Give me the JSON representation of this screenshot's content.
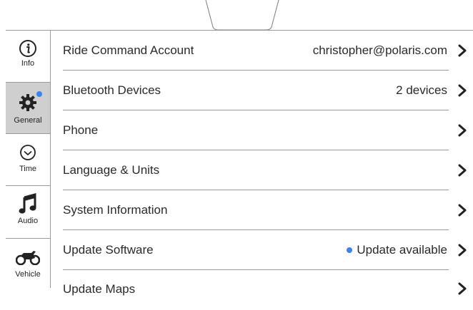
{
  "sidebar": {
    "items": [
      {
        "label": "Info",
        "icon": "info-icon"
      },
      {
        "label": "General",
        "icon": "gear-icon",
        "active": true,
        "badge": true
      },
      {
        "label": "Time",
        "icon": "clock-icon"
      },
      {
        "label": "Audio",
        "icon": "music-note-icon"
      },
      {
        "label": "Vehicle",
        "icon": "motorcycle-icon"
      }
    ]
  },
  "rows": [
    {
      "label": "Ride Command Account",
      "value": "christopher@polaris.com"
    },
    {
      "label": "Bluetooth Devices",
      "value": "2 devices"
    },
    {
      "label": "Phone",
      "value": ""
    },
    {
      "label": "Language & Units",
      "value": ""
    },
    {
      "label": "System Information",
      "value": ""
    },
    {
      "label": "Update Software",
      "value": "Update available"
    },
    {
      "label": "Update Maps",
      "value": ""
    }
  ],
  "colors": {
    "accent": "#3b82f6",
    "active_bg": "#cfcfcf",
    "divider": "#9a9a9a"
  }
}
